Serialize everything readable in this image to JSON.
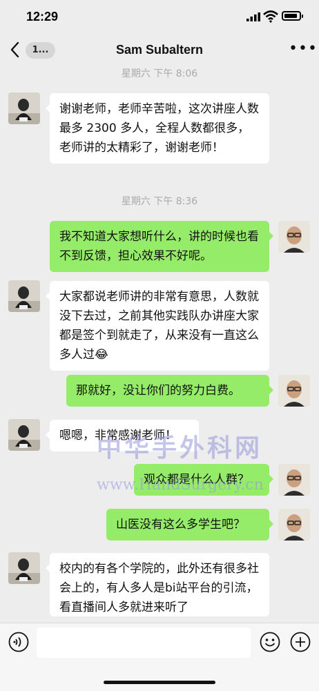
{
  "status": {
    "time": "12:29"
  },
  "nav": {
    "back_label": "1...",
    "title": "Sam Subaltern",
    "more_label": "•••"
  },
  "timestamps": [
    "星期六 下午 8:06",
    "星期六 下午 8:36"
  ],
  "messages": [
    {
      "side": "in",
      "text": "谢谢老师，老师辛苦啦，这次讲座人数最多 2300 多人，全程人数都很多，老师讲的太精彩了，谢谢老师！"
    },
    {
      "side": "out",
      "text": "我不知道大家想听什么，讲的时候也看不到反馈，担心效果不好呢。"
    },
    {
      "side": "in",
      "text": "大家都说老师讲的非常有意思，人数就没下去过，之前其他实践队办讲座大家都是签个到就走了，从来没有一直这么多人过😂"
    },
    {
      "side": "out",
      "text": "那就好，没让你们的努力白费。"
    },
    {
      "side": "in",
      "text": "嗯嗯，非常感谢老师！"
    },
    {
      "side": "out",
      "text": "观众都是什么人群？"
    },
    {
      "side": "out",
      "text": "山医没有这么多学生吧？"
    },
    {
      "side": "in",
      "text": "校内的有各个学院的，此外还有很多社会上的，有人多人是bi站平台的引流，看直播间人多就进来听了"
    }
  ],
  "watermark": {
    "line1": "中华手外科网",
    "line2": "www.HandSurgery.cn"
  },
  "colors": {
    "outgoing_bubble": "#95ec69",
    "incoming_bubble": "#ffffff",
    "background": "#ededed"
  },
  "icons": [
    "back-icon",
    "more-icon",
    "voice-icon",
    "emoji-icon",
    "plus-icon"
  ]
}
